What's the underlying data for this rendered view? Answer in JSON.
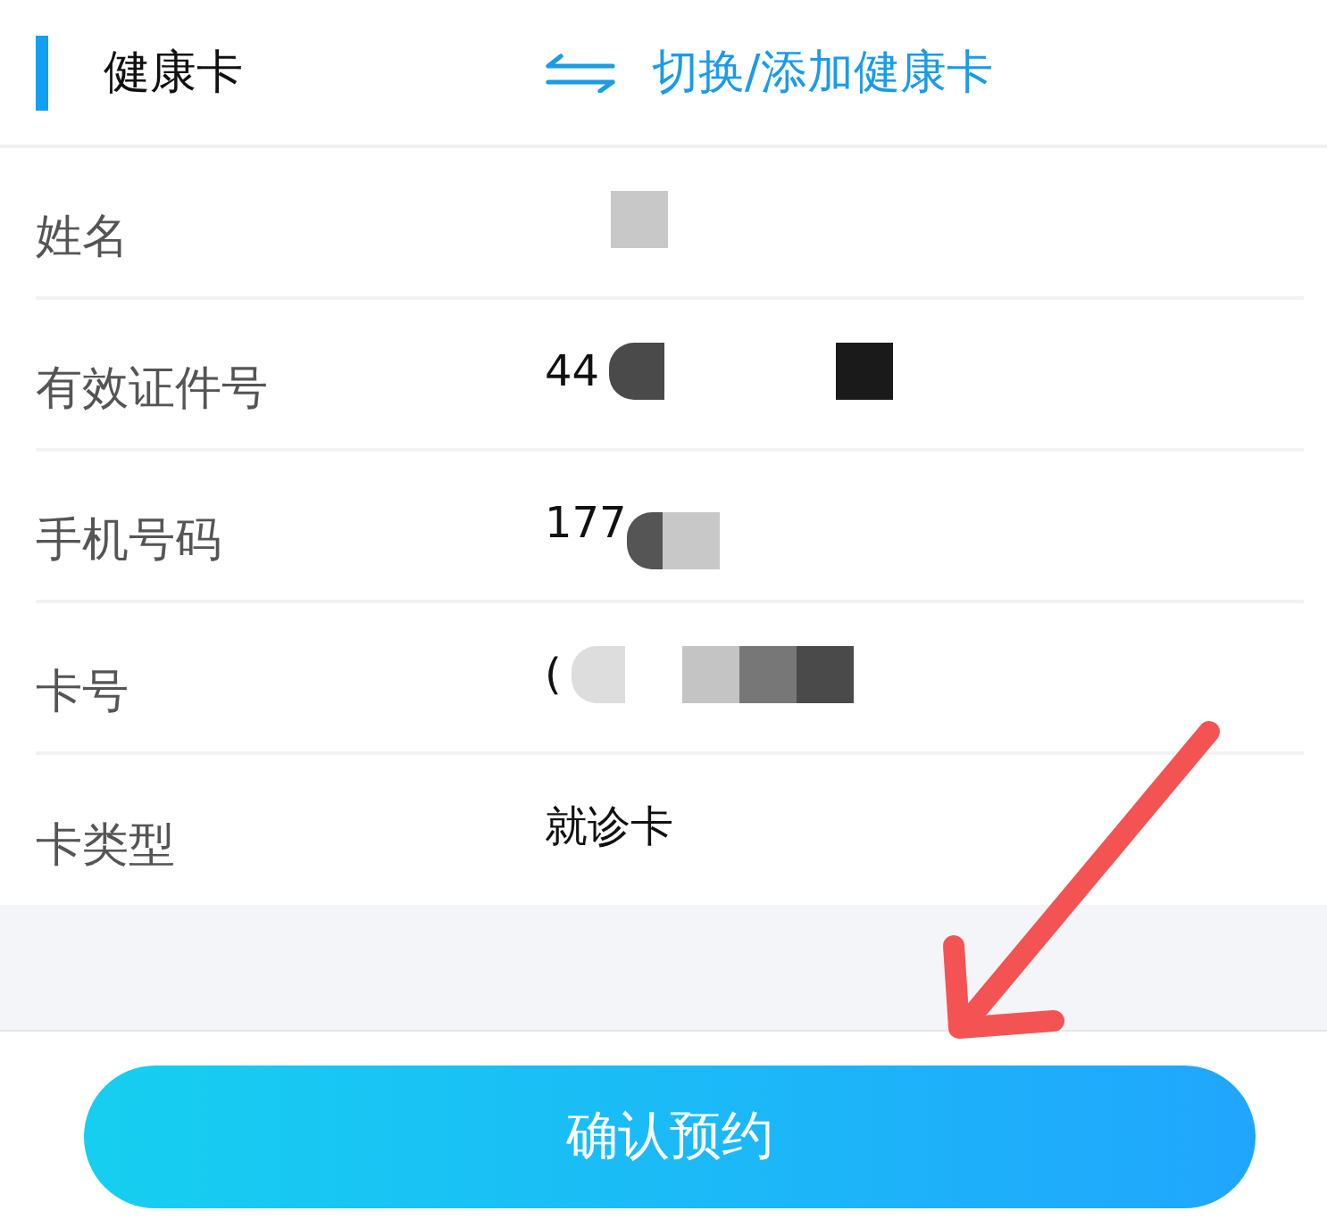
{
  "header": {
    "title": "健康卡",
    "switch_link": {
      "label": "切换/添加健康卡"
    }
  },
  "fields": [
    {
      "label": "姓名",
      "redacted": true
    },
    {
      "label": "有效证件号",
      "value": "44",
      "redacted": true
    },
    {
      "label": "手机号码",
      "value": "177",
      "redacted": true
    },
    {
      "label": "卡号",
      "value": "(",
      "redacted": true
    },
    {
      "label": "卡类型",
      "value": "就诊卡",
      "redacted": false
    }
  ],
  "confirm_button": {
    "label": "确认预约"
  },
  "annotation": {
    "kind": "arrow"
  }
}
